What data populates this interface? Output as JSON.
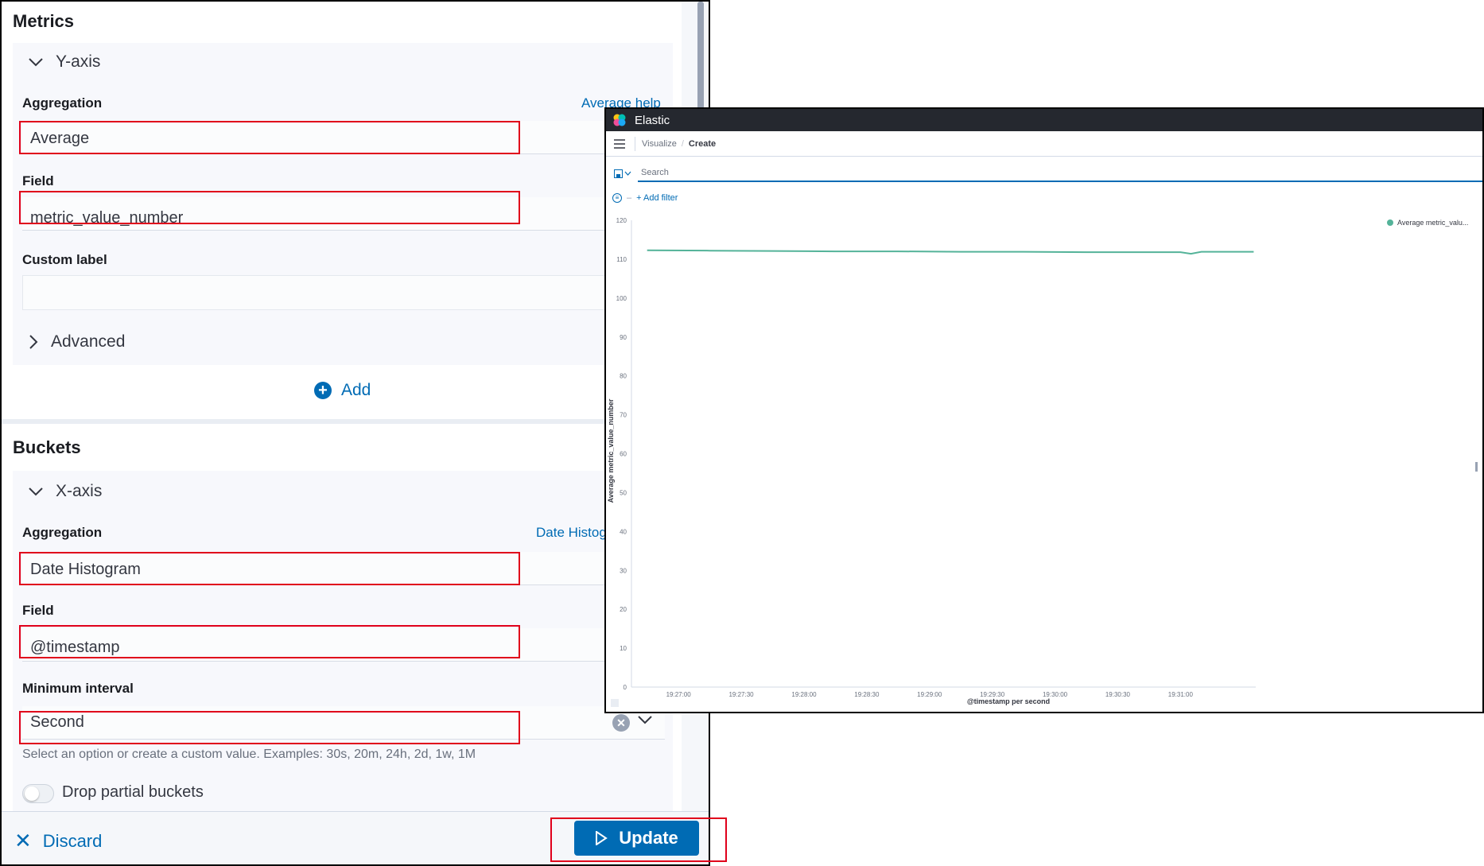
{
  "metrics": {
    "title": "Metrics",
    "y_axis": {
      "header": "Y-axis",
      "aggregation_label": "Aggregation",
      "aggregation_help": "Average help",
      "aggregation_value": "Average",
      "field_label": "Field",
      "field_value": "metric_value_number",
      "custom_label_label": "Custom label",
      "custom_label_value": "",
      "advanced_label": "Advanced"
    },
    "add_label": "Add"
  },
  "buckets": {
    "title": "Buckets",
    "x_axis": {
      "header": "X-axis",
      "aggregation_label": "Aggregation",
      "aggregation_help": "Date Histog",
      "aggregation_value": "Date Histogram",
      "field_label": "Field",
      "field_value": "@timestamp",
      "interval_label": "Minimum interval",
      "interval_value": "Second",
      "interval_help": "Select an option or create a custom value. Examples: 30s, 20m, 24h, 2d, 1w, 1M",
      "drop_partial_label": "Drop partial buckets"
    }
  },
  "footer": {
    "discard_label": "Discard",
    "update_label": "Update"
  },
  "kibana": {
    "app_title": "Elastic",
    "breadcrumb_parent": "Visualize",
    "breadcrumb_current": "Create",
    "search_placeholder": "Search",
    "add_filter_label": "+ Add filter"
  },
  "colors": {
    "accent": "#006bb4",
    "highlight_box": "#e0001b",
    "series_line": "#54b399"
  },
  "chart_data": {
    "type": "line",
    "ylabel": "Average metric_value_number",
    "xlabel": "@timestamp per second",
    "ylim": [
      0,
      120
    ],
    "y_ticks": [
      0,
      10,
      20,
      30,
      40,
      50,
      60,
      70,
      80,
      90,
      100,
      110,
      120
    ],
    "x_ticks": [
      "19:27:00",
      "19:27:30",
      "19:28:00",
      "19:28:30",
      "19:29:00",
      "19:29:30",
      "19:30:00",
      "19:30:30",
      "19:31:00"
    ],
    "legend_position": "top-right",
    "series": [
      {
        "name": "Average metric_valu...",
        "x": [
          "19:26:45",
          "19:27:15",
          "19:27:45",
          "19:28:15",
          "19:28:45",
          "19:29:15",
          "19:29:45",
          "19:30:15",
          "19:30:45",
          "19:31:00",
          "19:31:05",
          "19:31:10",
          "19:31:35"
        ],
        "values": [
          112.3,
          112.2,
          112.1,
          112.0,
          112.0,
          111.9,
          111.9,
          111.8,
          111.8,
          111.8,
          111.4,
          111.9,
          111.9
        ]
      }
    ]
  }
}
